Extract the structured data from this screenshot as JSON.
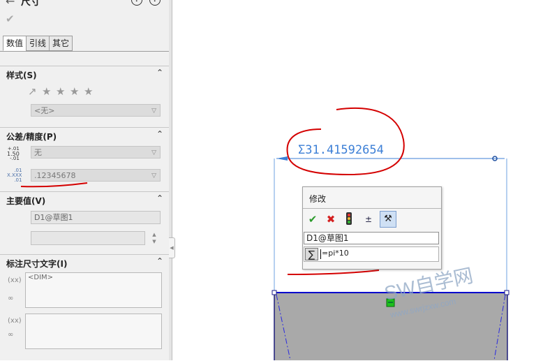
{
  "panel": {
    "title": "尺寸",
    "tabs": [
      "数值",
      "引线",
      "其它"
    ],
    "style_section": {
      "title": "样式(S)",
      "combo": "<无>"
    },
    "tolerance_section": {
      "title": "公差/精度(P)",
      "tolerance_combo": "无",
      "precision_combo": ".12345678",
      "tol_icon_lines": [
        "+.01",
        "1.50",
        "-.01"
      ],
      "prec_icon_lines": [
        ".01",
        "X.XXX",
        ".01"
      ]
    },
    "primary_section": {
      "title": "主要值(V)",
      "name_field": "D1@草图1",
      "value_field": ""
    },
    "dimtext_section": {
      "title": "标注尺寸文字(I)",
      "text1": "<DIM>",
      "text2": ""
    }
  },
  "canvas": {
    "dimension_text": "Σ31.41592654",
    "watermark": "SW自学网",
    "watermark_url": "www.swrjzxw.com",
    "annotation_color": "#d40000",
    "dimension_color": "#3c7fd6"
  },
  "dialog": {
    "title": "修改",
    "name_value": "D1@草图1",
    "formula_value": "=pi*10",
    "buttons": [
      "ok-check-icon",
      "cancel-x-icon",
      "traffic-light-icon",
      "spin-increment-icon",
      "mark-dimension-icon"
    ]
  }
}
